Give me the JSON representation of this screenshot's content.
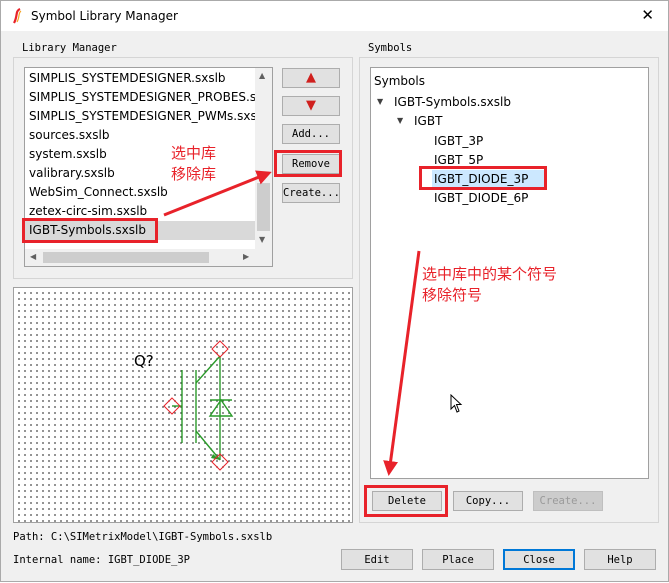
{
  "window": {
    "title": "Symbol Library Manager",
    "close_glyph": "✕"
  },
  "library_manager": {
    "group_title": "Library Manager",
    "items": [
      "SIMPLIS_SYSTEMDESIGNER.sxslb",
      "SIMPLIS_SYSTEMDESIGNER_PROBES.sxslb",
      "SIMPLIS_SYSTEMDESIGNER_PWMs.sxslb",
      "sources.sxslb",
      "system.sxslb",
      "valibrary.sxslb",
      "WebSim_Connect.sxslb",
      "zetex-circ-sim.sxslb",
      "IGBT-Symbols.sxslb"
    ],
    "selected_index": 8,
    "buttons": {
      "up": "▲",
      "down": "▼",
      "add": "Add...",
      "remove": "Remove",
      "create": "Create..."
    }
  },
  "preview": {
    "ref_label": "Q?"
  },
  "symbols": {
    "group_title": "Symbols",
    "tree_header": "Symbols",
    "library": "IGBT-Symbols.sxslb",
    "category": "IGBT",
    "items": [
      "IGBT_3P",
      "IGBT_5P",
      "IGBT_DIODE_3P",
      "IGBT_DIODE_6P"
    ],
    "selected_index": 2,
    "buttons": {
      "delete": "Delete",
      "copy": "Copy...",
      "create": "Create..."
    }
  },
  "footer": {
    "path": "Path: C:\\SIMetrixModel\\IGBT-Symbols.sxslb",
    "internal_name": "Internal name: IGBT_DIODE_3P",
    "buttons": {
      "edit": "Edit",
      "place": "Place",
      "close": "Close",
      "help": "Help"
    }
  },
  "annotations": {
    "remove_lib": [
      "选中库",
      "移除库"
    ],
    "remove_symbol": [
      "选中库中的某个符号",
      "移除符号"
    ]
  },
  "colors": {
    "annotation": "#e8222a",
    "selection": "#cce8ff",
    "focus": "#0078d7",
    "symbol_green": "#2a9a2a"
  }
}
